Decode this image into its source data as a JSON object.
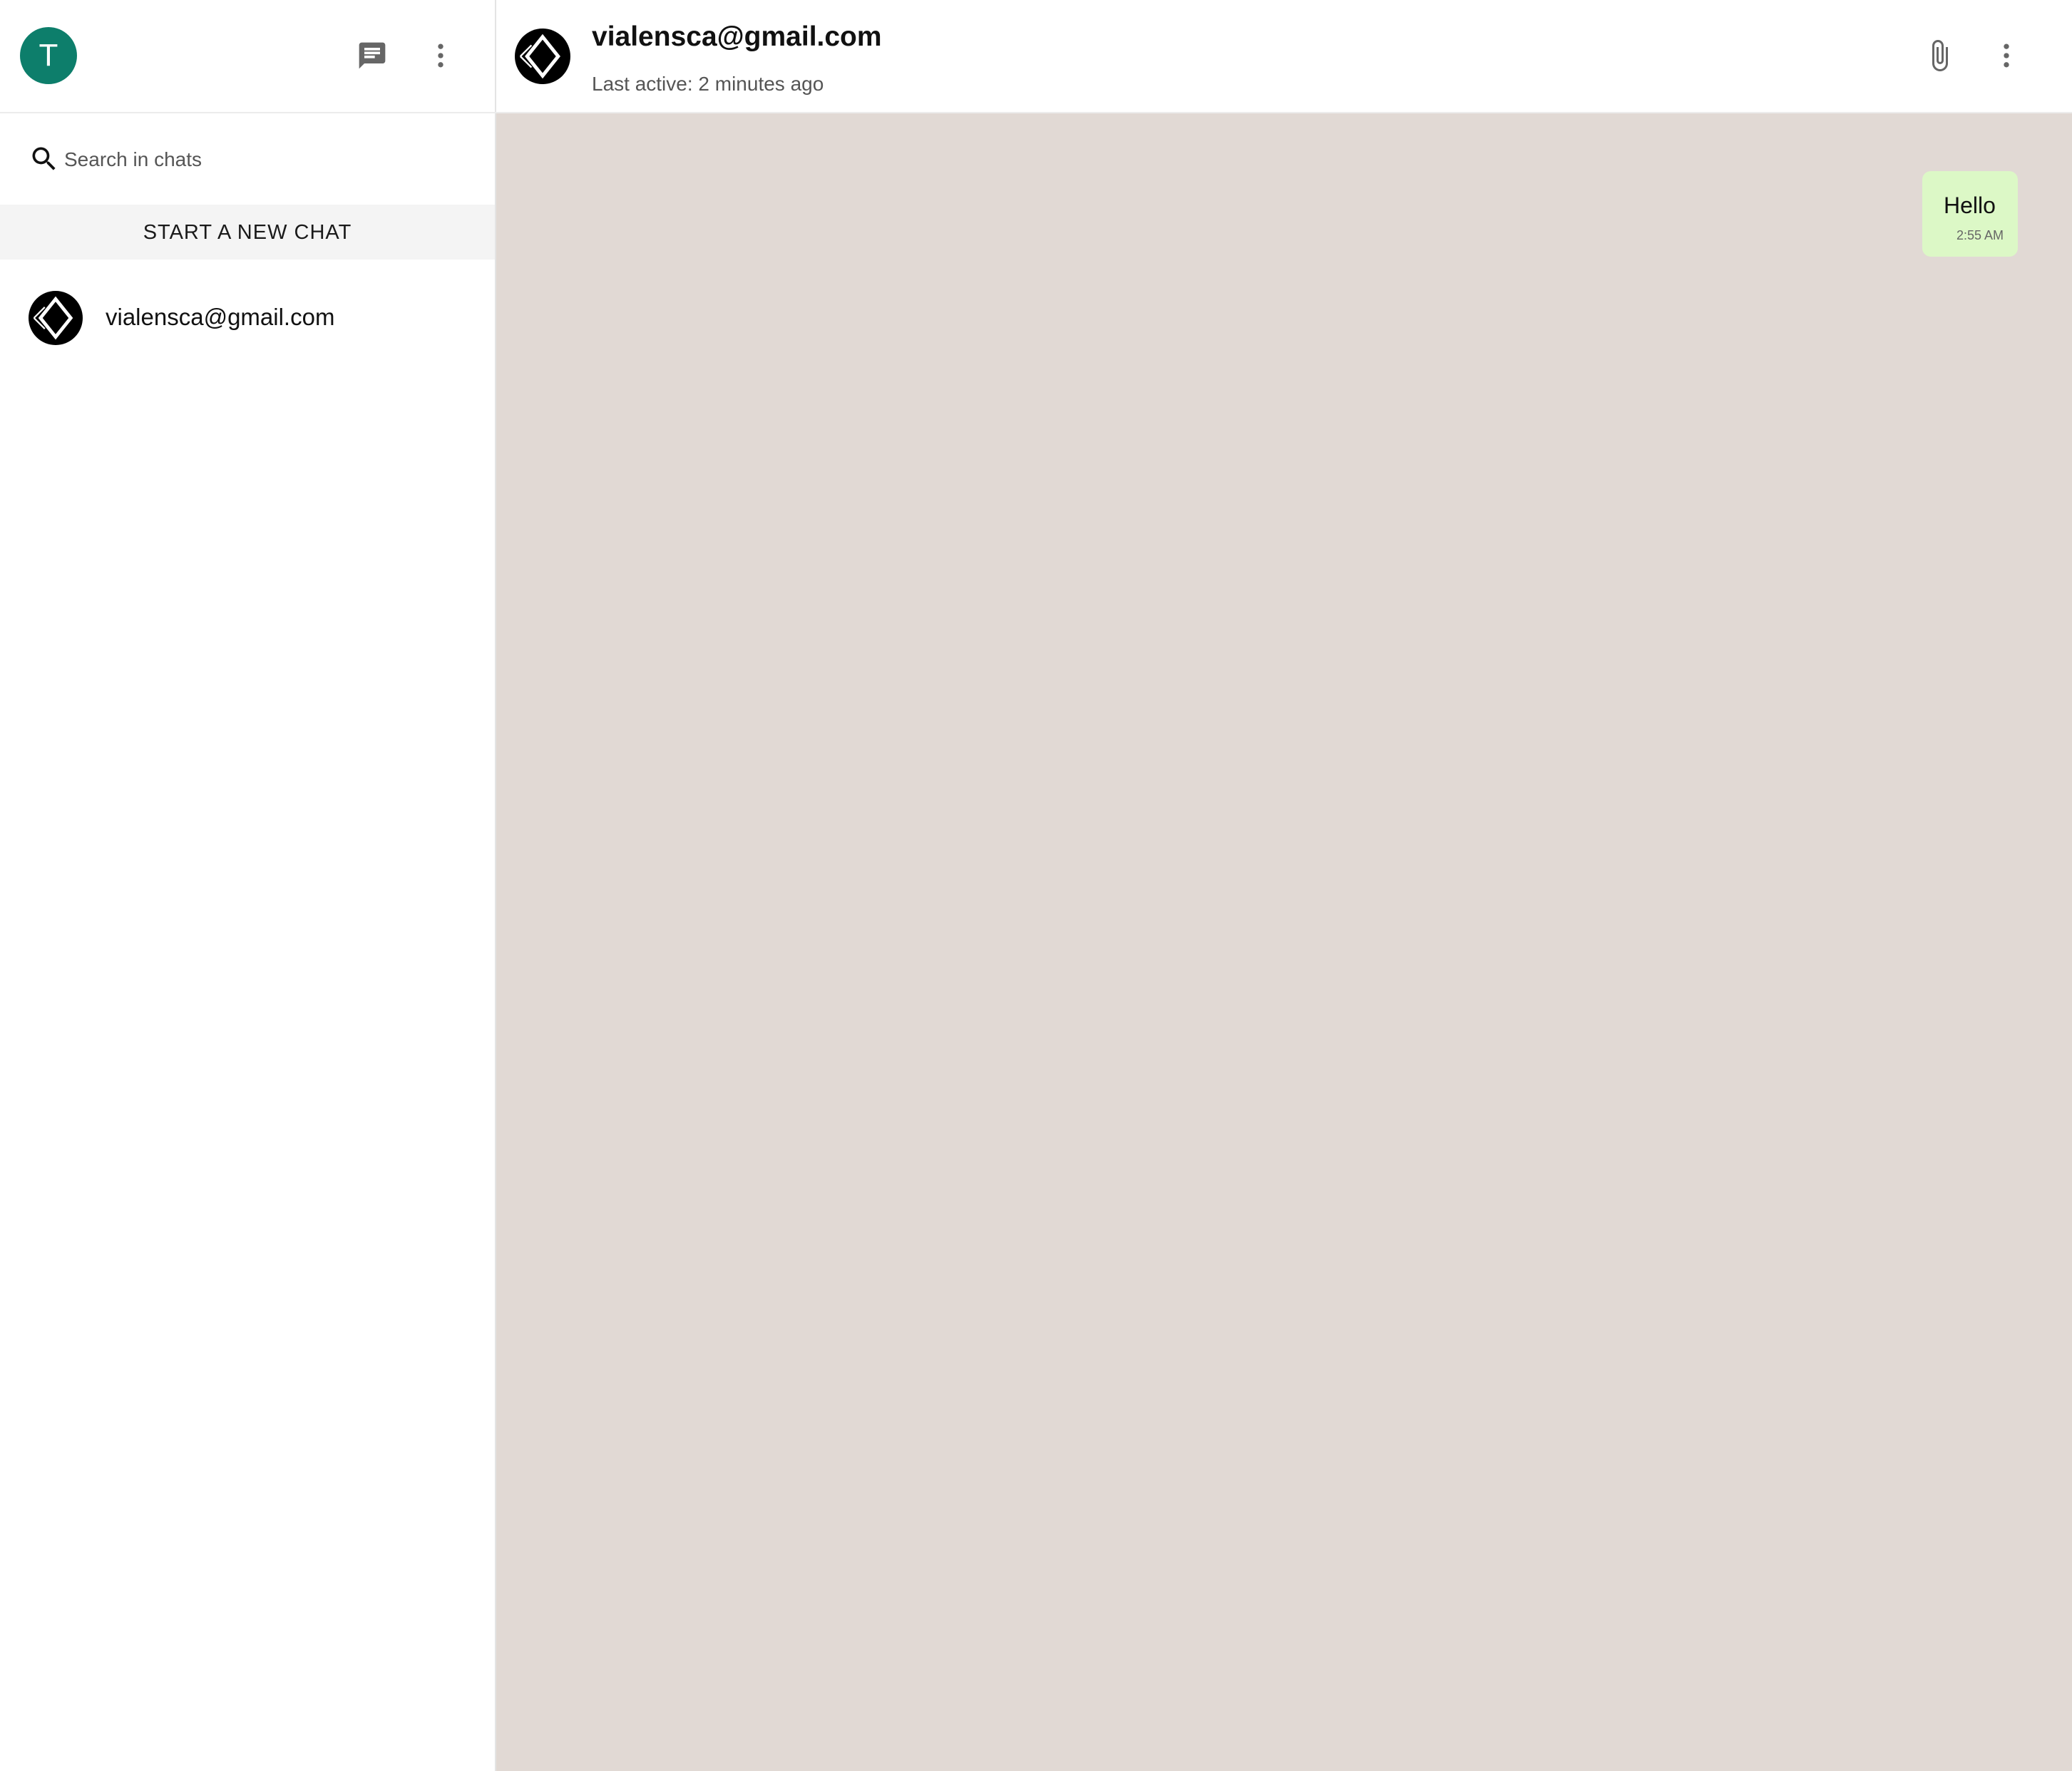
{
  "sidebar": {
    "user_avatar_initial": "T",
    "search": {
      "placeholder": "Search in chats"
    },
    "new_chat_label": "START A NEW CHAT",
    "chats": [
      {
        "name": "vialensca@gmail.com"
      }
    ]
  },
  "conversation": {
    "contact_name": "vialensca@gmail.com",
    "status": "Last active: 2 minutes ago",
    "messages": [
      {
        "text": "Hello",
        "time": "2:55 AM",
        "outgoing": true
      }
    ]
  },
  "colors": {
    "avatar_bg": "#0d7e6b",
    "chat_bg": "#e1d9d4",
    "outgoing_bubble": "#dcf8c6"
  },
  "icons": [
    "chat-icon",
    "more-vert-icon",
    "search-icon",
    "attach-icon",
    "more-vert-icon"
  ]
}
